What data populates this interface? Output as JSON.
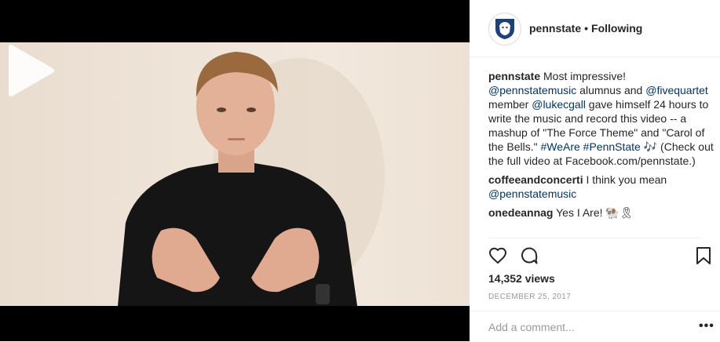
{
  "post": {
    "username": "pennstate",
    "follow_status": "Following",
    "separator": "•",
    "caption": {
      "username": "pennstate",
      "parts": [
        {
          "text": " Most impressive! "
        },
        {
          "text": "@pennstatemusic",
          "link": true
        },
        {
          "text": " alumnus and "
        },
        {
          "text": "@fivequartet",
          "link": true
        },
        {
          "text": " member "
        },
        {
          "text": "@lukecgall",
          "link": true
        },
        {
          "text": " gave himself 24 hours to write the music and record this video -- a mashup of \"The Force Theme\" and \"Carol of the Bells.\" "
        },
        {
          "text": "#WeAre",
          "link": true
        },
        {
          "text": " "
        },
        {
          "text": "#PennState",
          "link": true
        },
        {
          "text": " 🎶 (Check out the full video at Facebook.com/pennstate.)"
        }
      ]
    },
    "comments": [
      {
        "username": "coffeeandconcerti",
        "parts": [
          {
            "text": " I think you mean "
          },
          {
            "text": "@pennstatemusic",
            "link": true
          }
        ]
      },
      {
        "username": "onedeannag",
        "parts": [
          {
            "text": " Yes I Are! 🐏🎗"
          }
        ]
      }
    ],
    "views": "14,352 views",
    "date": "DECEMBER 25, 2017",
    "comment_placeholder": "Add a comment...",
    "more_label": "•••"
  },
  "icons": {
    "like": "heart-icon",
    "comment": "comment-icon",
    "save": "bookmark-icon",
    "play": "play-icon",
    "avatar": "nittany-lion-shield-logo"
  },
  "colors": {
    "link": "#003569",
    "muted": "#999999",
    "text": "#262626",
    "logo_navy": "#1e407c"
  }
}
